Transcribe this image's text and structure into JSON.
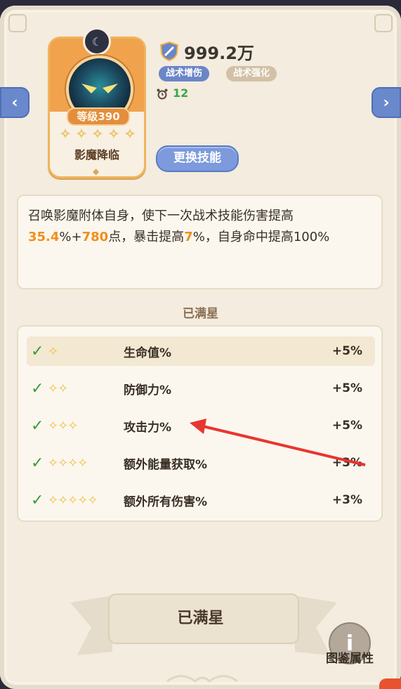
{
  "skill_card": {
    "level": "等级390",
    "name": "影魔降临",
    "stars": [
      "✧",
      "✧",
      "✧",
      "✧",
      "✧"
    ]
  },
  "power": {
    "value": "999.2万"
  },
  "tags": [
    "战术增伤",
    "战术强化"
  ],
  "cooldown": {
    "value": "12"
  },
  "buttons": {
    "change_skill": "更换技能",
    "max_star": "已满星",
    "codex": "图鉴属性",
    "prev": "‹",
    "next": "›"
  },
  "description": {
    "line1": "召唤影魔附体自身，使下一次战术技能伤害提高",
    "p1": "35.4",
    "t1": "%+",
    "p2": "780",
    "t2": "点，暴击提高",
    "p3": "7",
    "t3": "%，自身命中提高100%"
  },
  "section_title": "已满星",
  "star_rows": [
    {
      "stars": "✧",
      "label": "生命值%",
      "value": "+5%"
    },
    {
      "stars": "✧✧",
      "label": "防御力%",
      "value": "+5%"
    },
    {
      "stars": "✧✧✧",
      "label": "攻击力%",
      "value": "+5%"
    },
    {
      "stars": "✧✧✧✧",
      "label": "额外能量获取%",
      "value": "+3%"
    },
    {
      "stars": "✧✧✧✧✧",
      "label": "额外所有伤害%",
      "value": "+3%"
    }
  ],
  "colors": {
    "accent_blue": "#7c9adc",
    "orange": "#f1a24c",
    "highlight": "#f08f1a",
    "green": "#3aa64a",
    "annotation_arrow": "#e8352f"
  }
}
